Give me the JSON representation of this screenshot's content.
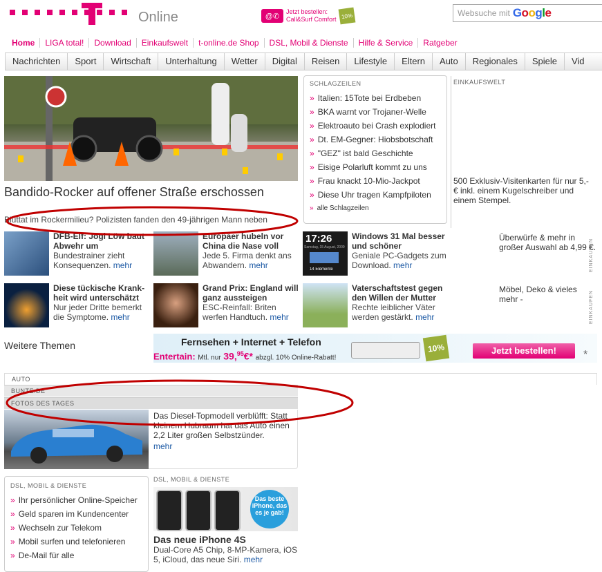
{
  "header": {
    "brand": "Online",
    "promo_text_1": "Jetzt bestellen:",
    "promo_text_2": "Call&Surf Comfort",
    "promo_badge": "10%",
    "search_placeholder": "Websuche mit",
    "search_engine": "Google"
  },
  "topnav": [
    "Home",
    "LIGA total!",
    "Download",
    "Einkaufswelt",
    "t-online.de Shop",
    "DSL, Mobil & Dienste",
    "Hilfe & Service",
    "Ratgeber"
  ],
  "mainnav": [
    "Nachrichten",
    "Sport",
    "Wirtschaft",
    "Unterhaltung",
    "Wetter",
    "Digital",
    "Reisen",
    "Lifestyle",
    "Eltern",
    "Auto",
    "Regionales",
    "Spiele",
    "Vid"
  ],
  "hero": {
    "title": "Bandido-Rocker auf offener Straße erschossen",
    "subtitle": "Bluttat im Rockermilieu? Polizisten fanden den 49-jährigen Mann neben"
  },
  "schlagzeilen": {
    "heading": "SCHLAGZEILEN",
    "items": [
      "Italien: 15Tote bei Erdbeben",
      "BKA warnt vor Trojaner-Welle",
      "Elektroauto bei Crash explodiert",
      "Dt. EM-Gegner: Hiobsbotschaft",
      "\"GEZ\" ist bald Geschichte",
      "Eisige Polarluft kommt zu uns",
      "Frau knackt 10-Mio-Jackpot",
      "Diese Uhr tragen Kampfpiloten"
    ],
    "all": "alle Schlagzeilen"
  },
  "einkaufswelt": {
    "heading": "EINKAUFSWELT",
    "text": "500 Exklusiv-Visitenkarten für nur 5,- € inkl. einem Kugelschreiber und einem Stempel."
  },
  "teasers": [
    {
      "title": "DFB-Elf: Jogi Löw baut Abwehr um",
      "desc": "Bundestrainer zieht Konsequenzen.",
      "more": "mehr"
    },
    {
      "title": "Europäer hubeln vor China die Nase voll",
      "desc": "Jede 5. Firma denkt ans Abwandern.",
      "more": "mehr"
    },
    {
      "title": "Windows 31 Mal besser und schöner",
      "desc": "Geniale PC-Gadgets zum Download.",
      "more": "mehr"
    },
    {
      "title": "Diese tückische Krank-heit wird unterschätzt",
      "desc": "Nur jeder Dritte bemerkt die Symptome.",
      "more": "mehr"
    },
    {
      "title": "Grand Prix: England will ganz aussteigen",
      "desc": "ESC-Reinfall: Briten werfen Handtuch.",
      "more": "mehr"
    },
    {
      "title": "Vaterschaftstest gegen den Willen der Mutter",
      "desc": "Rechte leiblicher Väter werden gestärkt.",
      "more": "mehr"
    }
  ],
  "thumb_clock": {
    "time": "17:26",
    "date": "Samstag, 15 August, 2009",
    "elements": "14 Elemente"
  },
  "side_ads": [
    {
      "text": "Überwürfe & mehr in großer Auswahl ab 4,99 €.",
      "label": "EINKAUFEN"
    },
    {
      "text": "Möbel, Deko & vieles mehr -",
      "label": "EINKAUFEN"
    }
  ],
  "weitere": "Weitere Themen",
  "banner": {
    "headline": "Fernsehen + Internet + Telefon",
    "lead": "Entertain:",
    "small_1": "Mtl. nur",
    "price": "39,",
    "price_cents": "95",
    "currency": "€*",
    "small_2": "abzgl. 10% Online-Rabatt!",
    "badge": "10%",
    "button": "Jetzt bestellen!",
    "star": "*"
  },
  "sections": {
    "auto": "AUTO",
    "bunte": "BUNTE.DE",
    "fotos": "FOTOS DES TAGES"
  },
  "diesel": {
    "text": "Das Diesel-Topmodell verblüfft: Statt kleinem Hubraum hat das Auto einen 2,2 Liter großen Selbstzünder.",
    "more": "mehr"
  },
  "dsl_box": {
    "heading": "DSL, MOBIL & DIENSTE",
    "items": [
      "Ihr persönlicher Online-Speicher",
      "Geld sparen im Kundencenter",
      "Wechseln zur Telekom",
      "Mobil surfen und telefonieren",
      "De-Mail für alle"
    ]
  },
  "iphone": {
    "heading": "DSL, MOBIL & DIENSTE",
    "bubble": "Das beste iPhone, das es je gab!",
    "title": "Das neue iPhone 4S",
    "desc": "Dual-Core A5 Chip, 8-MP-Kamera, iOS 5, iCloud, das neue Siri.",
    "more": "mehr"
  },
  "colors": {
    "brand": "#e20074",
    "link": "#1d5aa5",
    "annotation": "#c00000"
  }
}
